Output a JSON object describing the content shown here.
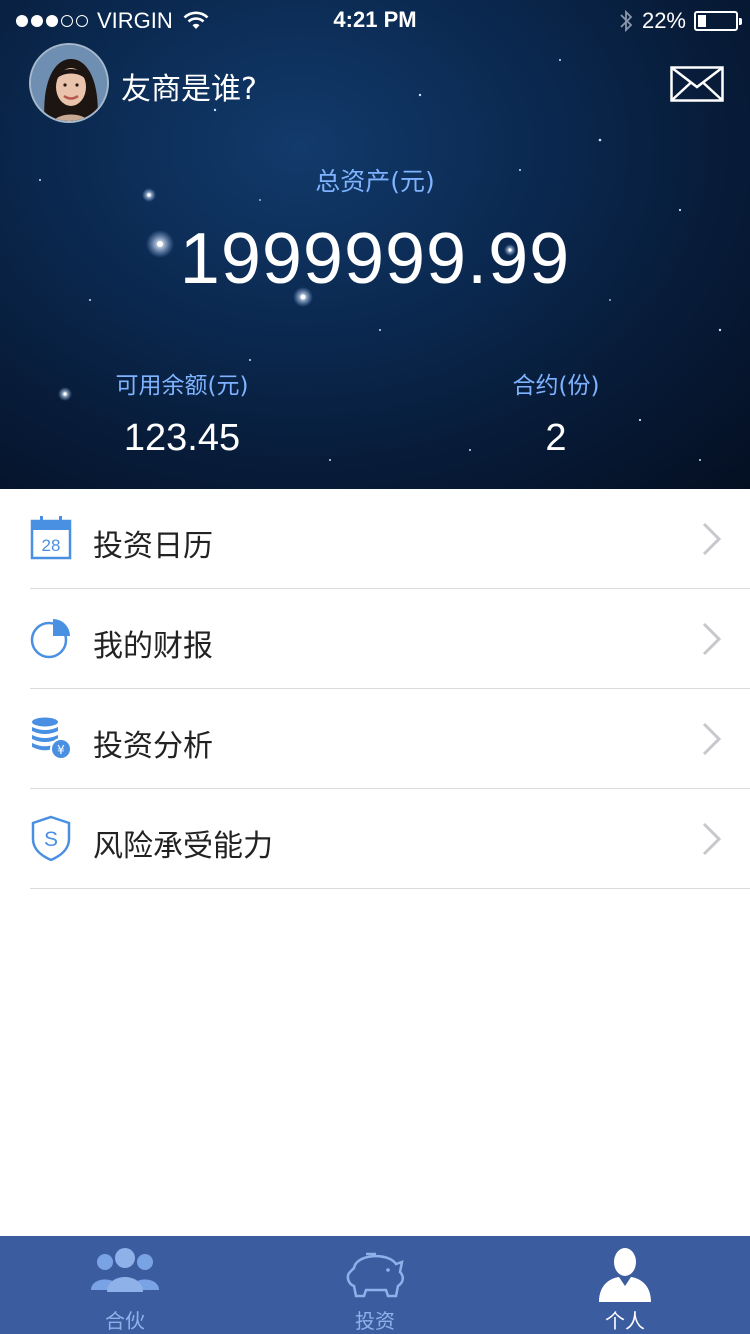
{
  "status_bar": {
    "carrier": "VIRGIN",
    "time": "4:21 PM",
    "battery_percent": "22%",
    "battery_level": 0.22,
    "signal_bars_filled": 3,
    "signal_bars_total": 5
  },
  "header": {
    "username": "友商是谁?",
    "total_assets_label": "总资产(元)",
    "total_assets_value": "1999999.99",
    "available_balance_label": "可用余额(元)",
    "available_balance_value": "123.45",
    "contracts_label": "合约(份)",
    "contracts_value": "2"
  },
  "menu": {
    "items": [
      {
        "label": "投资日历",
        "icon": "calendar-icon",
        "calendar_day": "28"
      },
      {
        "label": "我的财报",
        "icon": "pie-chart-icon"
      },
      {
        "label": "投资分析",
        "icon": "coins-yen-icon",
        "currency_symbol": "¥"
      },
      {
        "label": "风险承受能力",
        "icon": "shield-s-icon",
        "shield_letter": "S"
      }
    ]
  },
  "tabbar": {
    "tabs": [
      {
        "label": "合伙",
        "icon": "group-icon",
        "active": false
      },
      {
        "label": "投资",
        "icon": "piggy-bank-icon",
        "active": false
      },
      {
        "label": "个人",
        "icon": "person-icon",
        "active": true
      }
    ]
  },
  "colors": {
    "accent_blue": "#4a90e2",
    "label_blue": "#7fb3ff",
    "tabbar_bg": "#3c5ca0",
    "tab_inactive": "#8fb1ea",
    "header_bg": "#0b2a52"
  }
}
